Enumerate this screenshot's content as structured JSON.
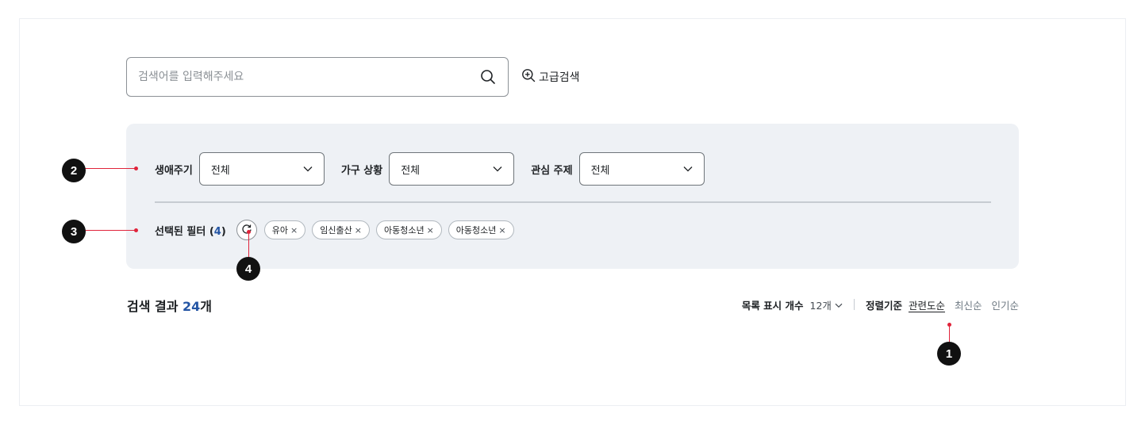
{
  "search": {
    "placeholder": "검색어를 입력해주세요",
    "advanced_label": "고급검색"
  },
  "filters": [
    {
      "label": "생애주기",
      "value": "전체"
    },
    {
      "label": "가구 상황",
      "value": "전체"
    },
    {
      "label": "관심 주제",
      "value": "전체"
    }
  ],
  "selected": {
    "label_prefix": "선택된 필터 (",
    "count": "4",
    "label_suffix": ")",
    "chips": [
      "유아",
      "임신출산",
      "아동청소년",
      "아동청소년"
    ],
    "chip_close": "×"
  },
  "results": {
    "prefix": "검색 결과 ",
    "count": "24",
    "suffix": "개"
  },
  "list_count": {
    "label": "목록 표시 개수",
    "value": "12개"
  },
  "sort": {
    "label": "정렬기준",
    "options": [
      "관련도순",
      "최신순",
      "인기순"
    ],
    "active_index": 0
  },
  "annotations": [
    "1",
    "2",
    "3",
    "4"
  ],
  "colors": {
    "accent": "#2455a4",
    "panel": "#eef1f5",
    "annotation": "#e0243b"
  },
  "icons": [
    "search-icon",
    "zoom-in-icon",
    "chevron-down-icon",
    "refresh-icon",
    "close-icon"
  ]
}
